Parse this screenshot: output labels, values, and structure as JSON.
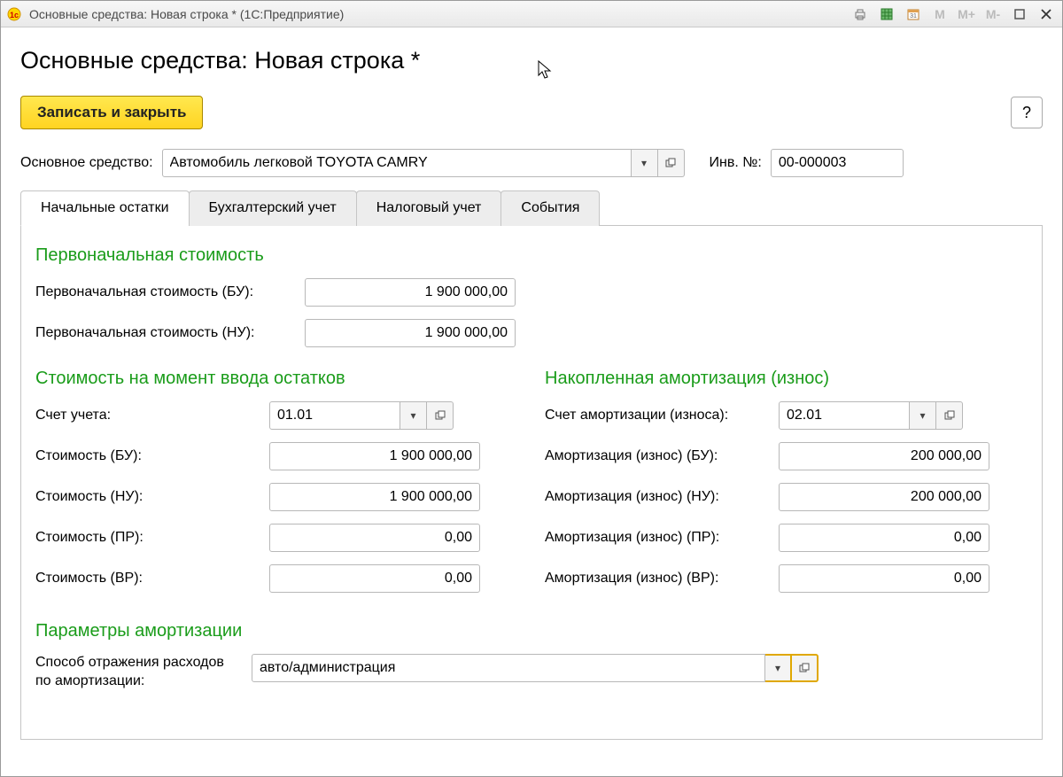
{
  "titlebar": {
    "title": "Основные средства: Новая строка *  (1С:Предприятие)",
    "memory_labels": [
      "M",
      "M+",
      "M-"
    ]
  },
  "heading": "Основные средства: Новая строка *",
  "buttons": {
    "save_close": "Записать и закрыть",
    "help": "?"
  },
  "main_asset": {
    "label": "Основное средство:",
    "value": "Автомобиль легковой TOYOTA CAMRY",
    "inv_label": "Инв. №:",
    "inv_value": "00-000003"
  },
  "tabs": [
    {
      "label": "Начальные остатки",
      "active": true
    },
    {
      "label": "Бухгалтерский учет",
      "active": false
    },
    {
      "label": "Налоговый учет",
      "active": false
    },
    {
      "label": "События",
      "active": false
    }
  ],
  "sections": {
    "initial_cost": {
      "title": "Первоначальная стоимость",
      "rows": [
        {
          "label": "Первоначальная стоимость (БУ):",
          "value": "1 900 000,00"
        },
        {
          "label": "Первоначальная стоимость (НУ):",
          "value": "1 900 000,00"
        }
      ]
    },
    "cost_at_entry": {
      "title": "Стоимость на момент ввода остатков",
      "account": {
        "label": "Счет учета:",
        "value": "01.01"
      },
      "rows": [
        {
          "label": "Стоимость (БУ):",
          "value": "1 900 000,00"
        },
        {
          "label": "Стоимость (НУ):",
          "value": "1 900 000,00"
        },
        {
          "label": "Стоимость (ПР):",
          "value": "0,00"
        },
        {
          "label": "Стоимость (ВР):",
          "value": "0,00"
        }
      ]
    },
    "depreciation": {
      "title": "Накопленная амортизация (износ)",
      "account": {
        "label": "Счет амортизации (износа):",
        "value": "02.01"
      },
      "rows": [
        {
          "label": "Амортизация (износ) (БУ):",
          "value": "200 000,00"
        },
        {
          "label": "Амортизация (износ) (НУ):",
          "value": "200 000,00"
        },
        {
          "label": "Амортизация (износ) (ПР):",
          "value": "0,00"
        },
        {
          "label": "Амортизация (износ) (ВР):",
          "value": "0,00"
        }
      ]
    },
    "params": {
      "title": "Параметры амортизации",
      "method": {
        "label": "Способ отражения расходов по амортизации:",
        "value": "авто/администрация"
      }
    }
  }
}
